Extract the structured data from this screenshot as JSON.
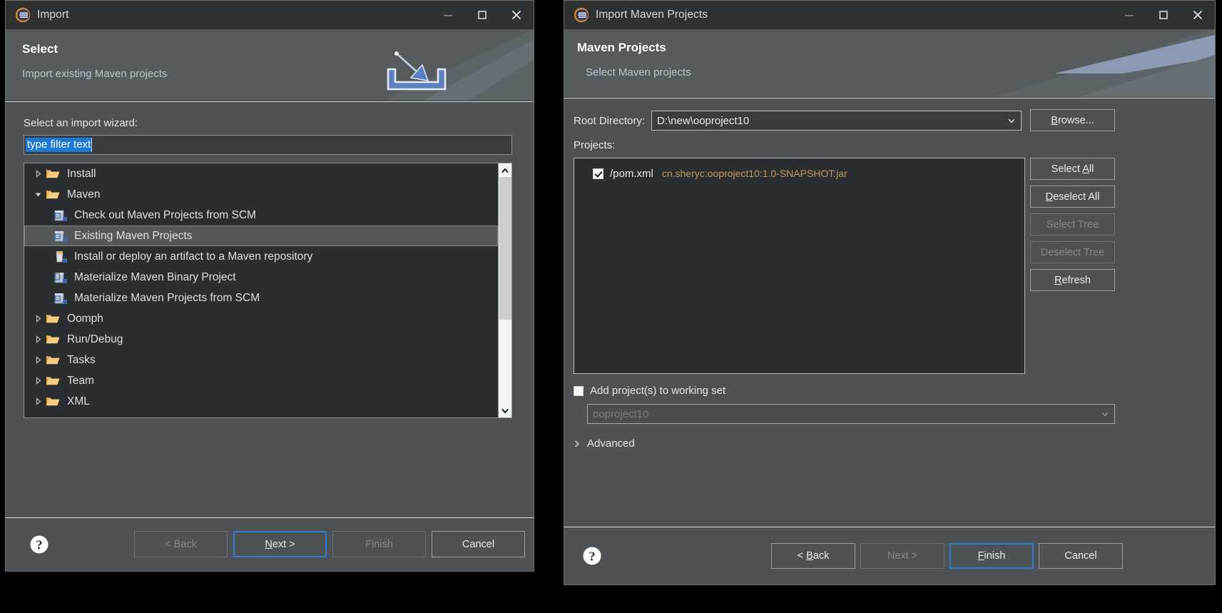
{
  "left_dialog": {
    "titlebar": {
      "logo_icon": "eclipse-logo-icon",
      "title": "Import",
      "minimize_icon": "minimize-icon",
      "maximize_icon": "maximize-icon",
      "close_icon": "close-icon"
    },
    "banner": {
      "title": "Select",
      "subtitle": "Import existing Maven projects",
      "art_icon": "import-wizard-banner-icon"
    },
    "prompt_label": "Select an import wizard:",
    "filter": {
      "value": "type filter text",
      "placeholder": "type filter text",
      "selected": true
    },
    "tree": [
      {
        "label": "Install",
        "level": 0,
        "expanded": false,
        "icon": "folder-icon",
        "selected": false
      },
      {
        "label": "Maven",
        "level": 0,
        "expanded": true,
        "icon": "folder-icon",
        "selected": false
      },
      {
        "label": "Check out Maven Projects from SCM",
        "level": 1,
        "expanded": null,
        "icon": "maven-wizard-icon",
        "selected": false
      },
      {
        "label": "Existing Maven Projects",
        "level": 1,
        "expanded": null,
        "icon": "maven-wizard-icon",
        "selected": true
      },
      {
        "label": "Install or deploy an artifact to a Maven repository",
        "level": 1,
        "expanded": null,
        "icon": "maven-deploy-icon",
        "selected": false
      },
      {
        "label": "Materialize Maven Binary Project",
        "level": 1,
        "expanded": null,
        "icon": "maven-binary-icon",
        "selected": false
      },
      {
        "label": "Materialize Maven Projects from SCM",
        "level": 1,
        "expanded": null,
        "icon": "maven-wizard-icon",
        "selected": false
      },
      {
        "label": "Oomph",
        "level": 0,
        "expanded": false,
        "icon": "folder-icon",
        "selected": false
      },
      {
        "label": "Run/Debug",
        "level": 0,
        "expanded": false,
        "icon": "folder-icon",
        "selected": false
      },
      {
        "label": "Tasks",
        "level": 0,
        "expanded": false,
        "icon": "folder-icon",
        "selected": false
      },
      {
        "label": "Team",
        "level": 0,
        "expanded": false,
        "icon": "folder-icon",
        "selected": false
      },
      {
        "label": "XML",
        "level": 0,
        "expanded": false,
        "icon": "folder-icon",
        "selected": false
      }
    ],
    "scrollbar": {
      "up_icon": "chevron-up-icon",
      "down_icon": "chevron-down-icon",
      "thumb_top_pct": 0,
      "thumb_height_pct": 62
    },
    "footer": {
      "help_icon": "help-icon",
      "buttons": [
        {
          "name": "back",
          "label": "< Back",
          "mnemonic": "",
          "state": "disabled"
        },
        {
          "name": "next",
          "label": "Next >",
          "mnemonic": "N",
          "state": "default"
        },
        {
          "name": "finish",
          "label": "Finish",
          "mnemonic": "",
          "state": "disabled"
        },
        {
          "name": "cancel",
          "label": "Cancel",
          "mnemonic": "",
          "state": "normal"
        }
      ]
    }
  },
  "right_dialog": {
    "titlebar": {
      "logo_icon": "eclipse-logo-icon",
      "title": "Import Maven Projects",
      "minimize_icon": "minimize-icon",
      "maximize_icon": "maximize-icon",
      "close_icon": "close-icon"
    },
    "banner": {
      "title": "Maven Projects",
      "subtitle": "Select Maven projects",
      "art_icon": "maven-wizard-banner-icon"
    },
    "root_directory": {
      "label": "Root Directory:",
      "value": "D:\\new\\ooproject10",
      "dropdown_icon": "chevron-down-icon",
      "browse_label": "Browse...",
      "browse_mnemonic": "B"
    },
    "projects_label": "Projects:",
    "projects": [
      {
        "checked": true,
        "pom": "/pom.xml",
        "coordinates": "cn.sheryc:ooproject10:1.0-SNAPSHOT:jar"
      }
    ],
    "side_buttons": [
      {
        "name": "select-all",
        "label": "Select All",
        "mnemonic": "A",
        "state": "normal"
      },
      {
        "name": "deselect-all",
        "label": "Deselect All",
        "mnemonic": "D",
        "state": "normal"
      },
      {
        "name": "select-tree",
        "label": "Select Tree",
        "mnemonic": "",
        "state": "disabled"
      },
      {
        "name": "deselect-tree",
        "label": "Deselect Tree",
        "mnemonic": "",
        "state": "disabled"
      },
      {
        "name": "refresh",
        "label": "Refresh",
        "mnemonic": "R",
        "state": "normal"
      }
    ],
    "working_set": {
      "checkbox_label": "Add project(s) to working set",
      "checked": false,
      "value": "ooproject10",
      "dropdown_icon": "chevron-down-icon",
      "disabled": true
    },
    "advanced": {
      "label": "Advanced",
      "expanded": false,
      "arrow_icon": "chevron-right-icon"
    },
    "footer": {
      "help_icon": "help-icon",
      "buttons": [
        {
          "name": "back",
          "label": "< Back",
          "mnemonic": "B",
          "state": "normal"
        },
        {
          "name": "next",
          "label": "Next >",
          "mnemonic": "",
          "state": "disabled"
        },
        {
          "name": "finish",
          "label": "Finish",
          "mnemonic": "F",
          "state": "default"
        },
        {
          "name": "cancel",
          "label": "Cancel",
          "mnemonic": "",
          "state": "normal"
        }
      ]
    }
  },
  "colors": {
    "window_bg": "#4e5254",
    "titlebar_bg": "#2f3133",
    "banner_bg": "#565b5e",
    "tree_bg": "#2b2e30",
    "accent_blue": "#2f7fd1",
    "selection_blue": "#1c7ad6",
    "coord_text": "#c29a5e",
    "subtitle_text": "#b9c6cf",
    "desktop_bg": "#000000"
  }
}
